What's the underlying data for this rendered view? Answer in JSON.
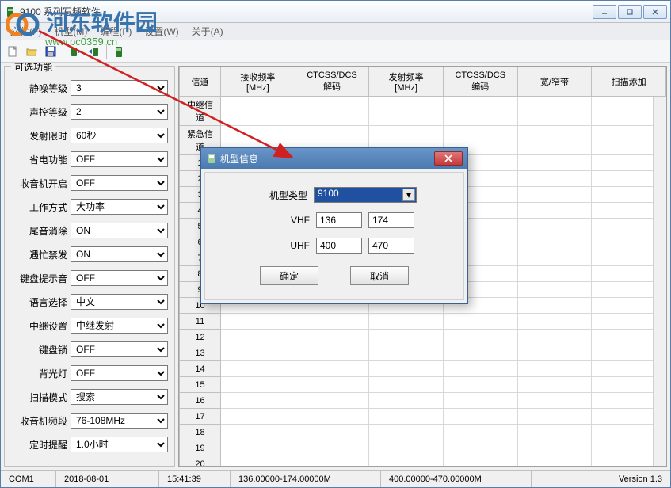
{
  "window": {
    "title": "9100 系列写频软件",
    "min_icon": "minimize",
    "max_icon": "maximize",
    "close_icon": "close"
  },
  "menubar": {
    "items": [
      "文件(F)",
      "机型(M)",
      "编程(P)",
      "设置(W)",
      "关于(A)"
    ]
  },
  "watermark": {
    "text1": "河东软件园",
    "url": "www.pc0359.cn"
  },
  "sidebar": {
    "group_title": "可选功能",
    "options": [
      {
        "label": "静噪等级",
        "value": "3"
      },
      {
        "label": "声控等级",
        "value": "2"
      },
      {
        "label": "发射限时",
        "value": "60秒"
      },
      {
        "label": "省电功能",
        "value": "OFF"
      },
      {
        "label": "收音机开启",
        "value": "OFF"
      },
      {
        "label": "工作方式",
        "value": "大功率"
      },
      {
        "label": "尾音消除",
        "value": "ON"
      },
      {
        "label": "遇忙禁发",
        "value": "ON"
      },
      {
        "label": "键盘提示音",
        "value": "OFF"
      },
      {
        "label": "语言选择",
        "value": "中文"
      },
      {
        "label": "中继设置",
        "value": "中继发射"
      },
      {
        "label": "键盘锁",
        "value": "OFF"
      },
      {
        "label": "背光灯",
        "value": "OFF"
      },
      {
        "label": "扫描模式",
        "value": "搜索"
      },
      {
        "label": "收音机频段",
        "value": "76-108MHz"
      },
      {
        "label": "定时提醒",
        "value": "1.0小时"
      }
    ]
  },
  "table": {
    "headers": [
      "信道",
      "接收频率\n[MHz]",
      "CTCSS/DCS\n解码",
      "发射频率\n[MHz]",
      "CTCSS/DCS\n编码",
      "宽/窄带",
      "扫描添加"
    ],
    "special_rows": [
      "中继信道",
      "紧急信道"
    ],
    "channel_rows": [
      "1",
      "2",
      "3",
      "4",
      "5",
      "6",
      "7",
      "8",
      "9",
      "10",
      "11",
      "12",
      "13",
      "14",
      "15",
      "16",
      "17",
      "18",
      "19",
      "20"
    ]
  },
  "dialog": {
    "title": "机型信息",
    "model_label": "机型类型",
    "model_value": "9100",
    "vhf_label": "VHF",
    "vhf_low": "136",
    "vhf_high": "174",
    "uhf_label": "UHF",
    "uhf_low": "400",
    "uhf_high": "470",
    "ok": "确定",
    "cancel": "取消"
  },
  "statusbar": {
    "port": "COM1",
    "date": "2018-08-01",
    "time": "15:41:39",
    "vhf_range": "136.00000-174.00000M",
    "uhf_range": "400.00000-470.00000M",
    "version": "Version 1.3"
  }
}
